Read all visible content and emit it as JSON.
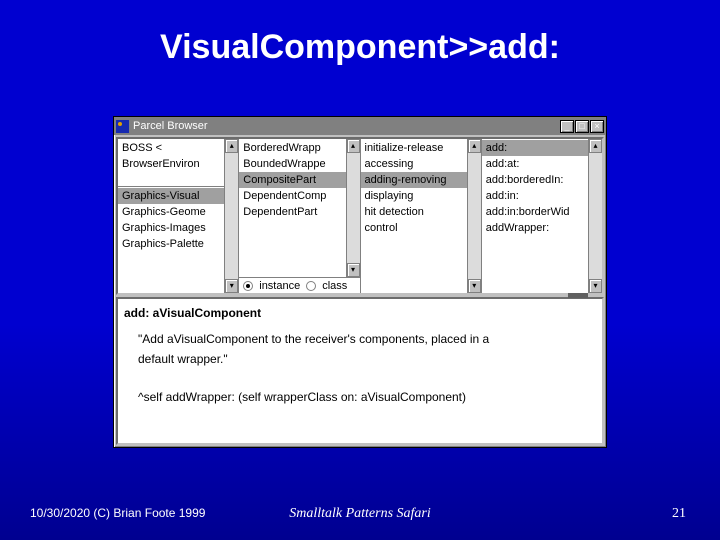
{
  "slide": {
    "title": "VisualComponent>>add:"
  },
  "window": {
    "title": "Parcel Browser",
    "buttons": {
      "min": "_",
      "max": "□",
      "close": "×"
    }
  },
  "pane1": {
    "upper": [
      "BOSS   <",
      "BrowserEnviron"
    ],
    "lower": [
      "Graphics-Visual",
      "Graphics-Geome",
      "Graphics-Images",
      "Graphics-Palette"
    ],
    "selected_lower": 0
  },
  "pane2": {
    "items": [
      "BorderedWrapp",
      "BoundedWrappe",
      "CompositePart",
      "DependentComp",
      "DependentPart"
    ],
    "selected": 2,
    "radios": {
      "instance": "instance",
      "class": "class"
    }
  },
  "pane3": {
    "items": [
      "initialize-release",
      "accessing",
      "adding-removing",
      "displaying",
      "hit detection",
      "control"
    ],
    "selected": 2
  },
  "pane4": {
    "items": [
      "add:",
      "add:at:",
      "add:borderedIn:",
      "add:in:",
      "add:in:borderWid",
      "addWrapper:"
    ],
    "selected": 0
  },
  "code": {
    "signature": "add: aVisualComponent",
    "comment1": "\"Add aVisualComponent to the receiver's components, placed in a",
    "comment2": "default wrapper.\"",
    "body": "^self addWrapper: (self wrapperClass on: aVisualComponent)"
  },
  "footer": {
    "left": "10/30/2020 (C) Brian Foote 1999",
    "center": "Smalltalk Patterns Safari",
    "right": "21"
  }
}
